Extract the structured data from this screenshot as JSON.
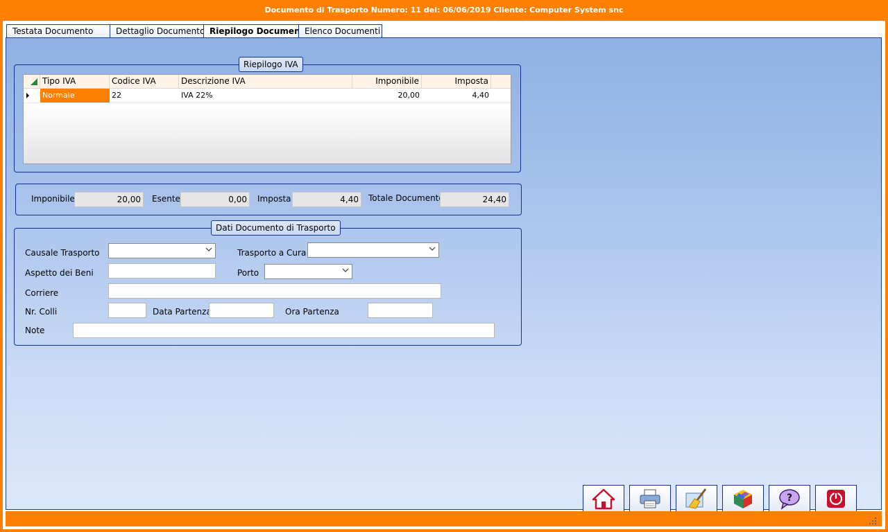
{
  "window": {
    "title": "Documento di Trasporto  Numero: 11 del: 06/06/2019 Cliente: Computer System snc"
  },
  "tabs": [
    "Testata Documento",
    "Dettaglio Documento",
    "Riepilogo Documento",
    "Elenco Documenti"
  ],
  "active_tab": "Riepilogo Documento",
  "riepilogo_iva": {
    "title": "Riepilogo IVA",
    "columns": [
      "Tipo IVA",
      "Codice IVA",
      "Descrizione IVA",
      "Imponibile",
      "Imposta"
    ],
    "rows": [
      {
        "tipo": "Normale",
        "codice": "22",
        "descrizione": "IVA 22%",
        "imponibile": "20,00",
        "imposta": "4,40"
      }
    ]
  },
  "totals": {
    "imponibile_label": "Imponibile",
    "imponibile": "20,00",
    "esente_label": "Esente",
    "esente": "0,00",
    "imposta_label": "Imposta",
    "imposta": "4,40",
    "totale_label": "Totale Documento",
    "totale": "24,40"
  },
  "trasporto": {
    "title": "Dati Documento di Trasporto",
    "causale_label": "Causale Trasporto",
    "causale_value": "",
    "a_cura_label": "Trasporto a Cura",
    "a_cura_value": "",
    "aspetto_label": "Aspetto dei Beni",
    "aspetto_value": "",
    "porto_label": "Porto",
    "porto_value": "",
    "corriere_label": "Corriere",
    "corriere_value": "",
    "colli_label": "Nr. Colli",
    "colli_value": "",
    "data_label": "Data Partenza",
    "data_value": "",
    "ora_label": "Ora Partenza",
    "ora_value": "",
    "note_label": "Note",
    "note_value": ""
  },
  "toolbar": [
    "home-icon",
    "printer-icon",
    "clean-broom-icon",
    "cube-icon",
    "help-icon",
    "power-icon"
  ],
  "colors": {
    "accent": "#ff8000",
    "border": "#142f8e",
    "selected_cell": "#ff8000"
  }
}
